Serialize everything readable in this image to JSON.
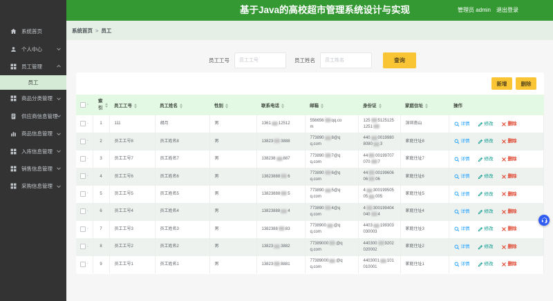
{
  "topbar": {
    "title": "基于Java的高校超市管理系统设计与实现",
    "user": "管理员 admin",
    "logout": "退出登录"
  },
  "sidebar": {
    "items": [
      {
        "label": "系统首页",
        "icon": "home-icon",
        "chevron": ""
      },
      {
        "label": "个人中心",
        "icon": "user-icon",
        "chevron": "down"
      },
      {
        "label": "员工管理",
        "icon": "grid-icon",
        "chevron": "up",
        "sub": [
          {
            "label": "员工",
            "active": true
          }
        ]
      },
      {
        "label": "商品分类管理",
        "icon": "grid-icon",
        "chevron": "down"
      },
      {
        "label": "供应商信息管理",
        "icon": "doc-icon",
        "chevron": "down"
      },
      {
        "label": "商品信息管理",
        "icon": "chart-icon",
        "chevron": "down"
      },
      {
        "label": "入库信息管理",
        "icon": "grid-icon",
        "chevron": "down"
      },
      {
        "label": "销售信息管理",
        "icon": "grid-icon",
        "chevron": "down"
      },
      {
        "label": "采购信息管理",
        "icon": "grid-icon",
        "chevron": "down"
      }
    ]
  },
  "breadcrumb": {
    "root": "系统首页",
    "current": "员工"
  },
  "search": {
    "field1_label": "员工工号",
    "field1_placeholder": "员工工号",
    "field2_label": "员工姓名",
    "field2_placeholder": "员工姓名",
    "query_label": "查询"
  },
  "toolbar": {
    "add_label": "新增",
    "delete_label": "删除"
  },
  "table": {
    "columns": [
      "索引",
      "员工工号",
      "员工姓名",
      "性别",
      "联系电话",
      "邮箱",
      "身份证",
      "家庭住址",
      "操作"
    ],
    "sortable": [
      true,
      true,
      true,
      true,
      true,
      true,
      true,
      true,
      false
    ],
    "actions": {
      "detail": "详情",
      "edit": "修改",
      "del": "删除"
    },
    "rows": [
      {
        "index": 1,
        "no": "111",
        "name": "胡月",
        "gender": "男",
        "phone": "1361▓12512",
        "email": "556656▓qq.com",
        "idcard": "125▓51251251251▓",
        "address": "深圳南山"
      },
      {
        "index": 2,
        "no": "员工工号8",
        "name": "员工姓名8",
        "gender": "男",
        "phone": "13823▓3888",
        "email": "773890▓8@qq.com",
        "idcard": "440▓00199808080▓3",
        "address": "家庭住址8"
      },
      {
        "index": 3,
        "no": "员工工号7",
        "name": "员工姓名7",
        "gender": "男",
        "phone": "138238▓887",
        "email": "773890▓7@qq.com",
        "idcard": "44▓00199707070▓7",
        "address": "家庭住址7"
      },
      {
        "index": 4,
        "no": "员工工号6",
        "name": "员工姓名6",
        "gender": "男",
        "phone": "13823888▓6",
        "email": "773890▓6@qq.com",
        "idcard": "44▓0019960606▓06",
        "address": "家庭住址6"
      },
      {
        "index": 5,
        "no": "员工工号5",
        "name": "员工姓名5",
        "gender": "男",
        "phone": "13823888▓5",
        "email": "773890▓5@qq.com",
        "idcard": "4▓30019950505▓005",
        "address": "家庭住址5"
      },
      {
        "index": 6,
        "no": "员工工号4",
        "name": "员工姓名4",
        "gender": "男",
        "phone": "13823888▓4",
        "email": "773890▓4@qq.com",
        "idcard": "4▓300199404040▓4",
        "address": "家庭住址4"
      },
      {
        "index": 7,
        "no": "员工工号3",
        "name": "员工姓名3",
        "gender": "男",
        "phone": "1382388▓83",
        "email": "7738900▓@qq.com",
        "idcard": "4403▓199303030003",
        "address": "家庭住址3"
      },
      {
        "index": 8,
        "no": "员工工号2",
        "name": "员工姓名2",
        "gender": "男",
        "phone": "13823▓3882",
        "email": "77389000▓@qq.com",
        "idcard": "440300▓9202020002",
        "address": "家庭住址2"
      },
      {
        "index": 9,
        "no": "员工工号1",
        "name": "员工姓名1",
        "gender": "男",
        "phone": "13823▓8881",
        "email": "77389000▓@qq.com",
        "idcard": "4403001▓101010001",
        "address": "家庭住址1"
      }
    ]
  },
  "float_button": {
    "name": "service-float-button"
  },
  "colors": {
    "header_green": "#349933",
    "sidebar_dark": "#333333",
    "table_head_green": "#e4f9e4",
    "stripe_green": "#edf2ef",
    "button_yellow": "#f9c535",
    "detail_blue": "#1e9fff",
    "edit_teal": "#009688",
    "delete_red": "#e0442e",
    "float_blue": "#315df5"
  }
}
